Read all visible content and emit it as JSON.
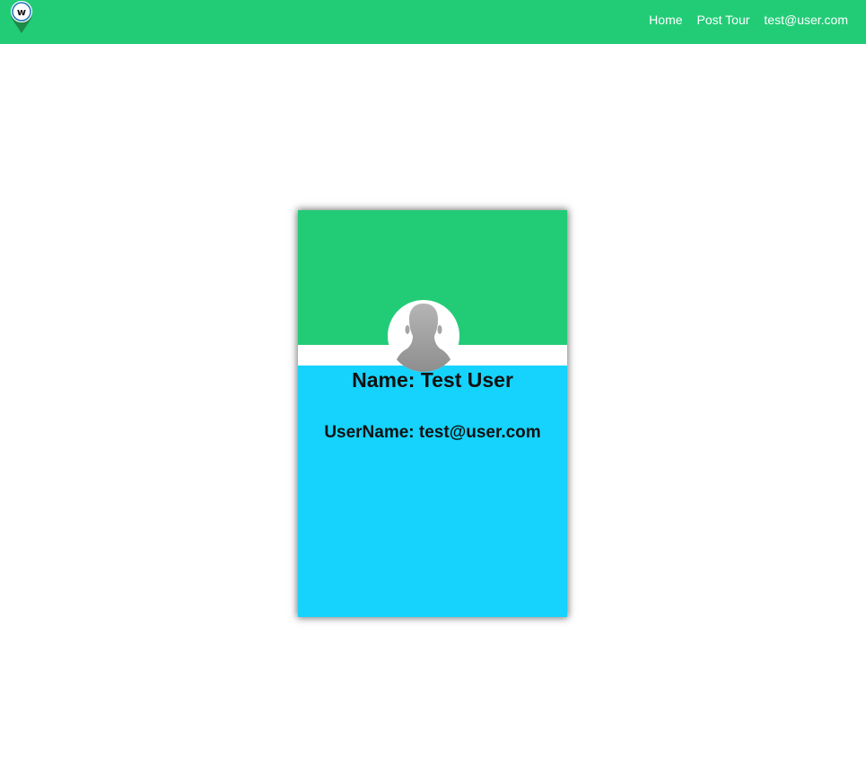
{
  "nav": {
    "links": [
      {
        "label": "Home"
      },
      {
        "label": "Post Tour"
      },
      {
        "label": "test@user.com"
      }
    ]
  },
  "profile": {
    "name_line": "Name: Test User",
    "username_line": "UserName: test@user.com"
  },
  "colors": {
    "navbar": "#22cc77",
    "card_top": "#22cc77",
    "card_bottom": "#15d3fc"
  },
  "icons": {
    "logo": "map-pin-logo-icon",
    "avatar": "default-user-silhouette-icon"
  }
}
